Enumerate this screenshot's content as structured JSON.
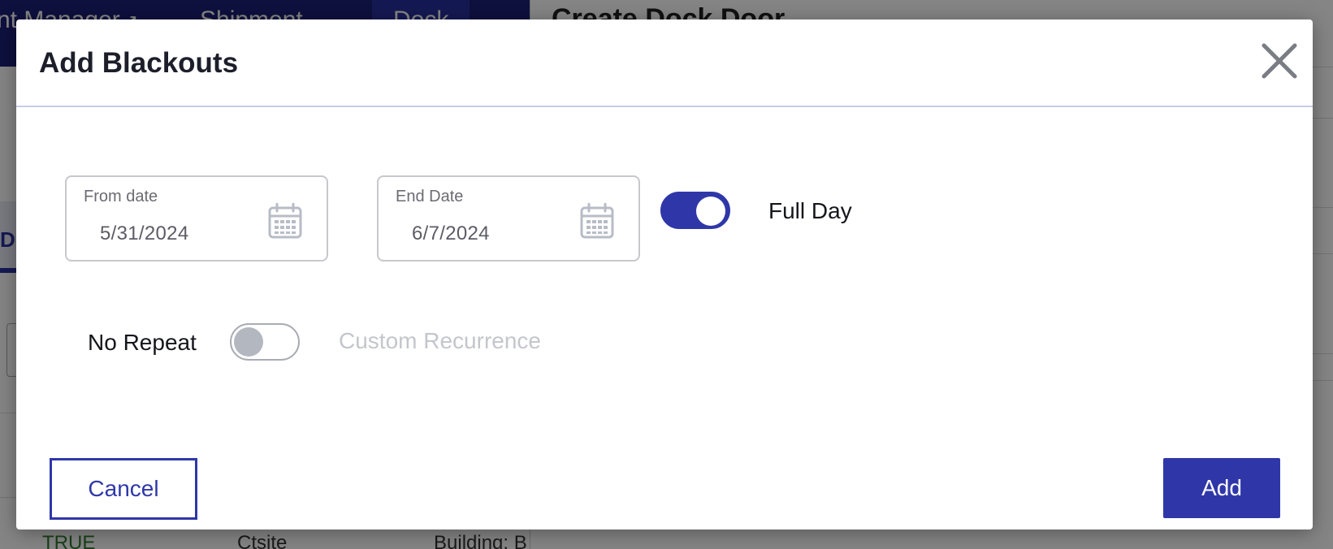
{
  "background": {
    "nav": {
      "item1": "nt Manager",
      "item1_icon": "external-link-icon",
      "item2": "Shipment",
      "item3": "Dock"
    },
    "page_title": "Create Dock Door",
    "tab_label": "D",
    "row": {
      "status": "TRUE",
      "site": "Ctsite",
      "building": "Building: B"
    }
  },
  "modal": {
    "title": "Add Blackouts",
    "close_icon": "close-icon",
    "from_date": {
      "label": "From date",
      "value": "5/31/2024",
      "icon": "calendar-icon"
    },
    "end_date": {
      "label": "End Date",
      "value": "6/7/2024",
      "icon": "calendar-icon"
    },
    "full_day": {
      "label": "Full Day",
      "enabled": true
    },
    "repeat": {
      "label": "No Repeat",
      "enabled": false
    },
    "custom_recurrence": "Custom Recurrence",
    "cancel_label": "Cancel",
    "add_label": "Add"
  },
  "colors": {
    "accent": "#2f37a8",
    "nav_bg": "#1b2077",
    "toggle_off_knob": "#b3b8c0",
    "disabled_text": "#c4c6cc"
  }
}
